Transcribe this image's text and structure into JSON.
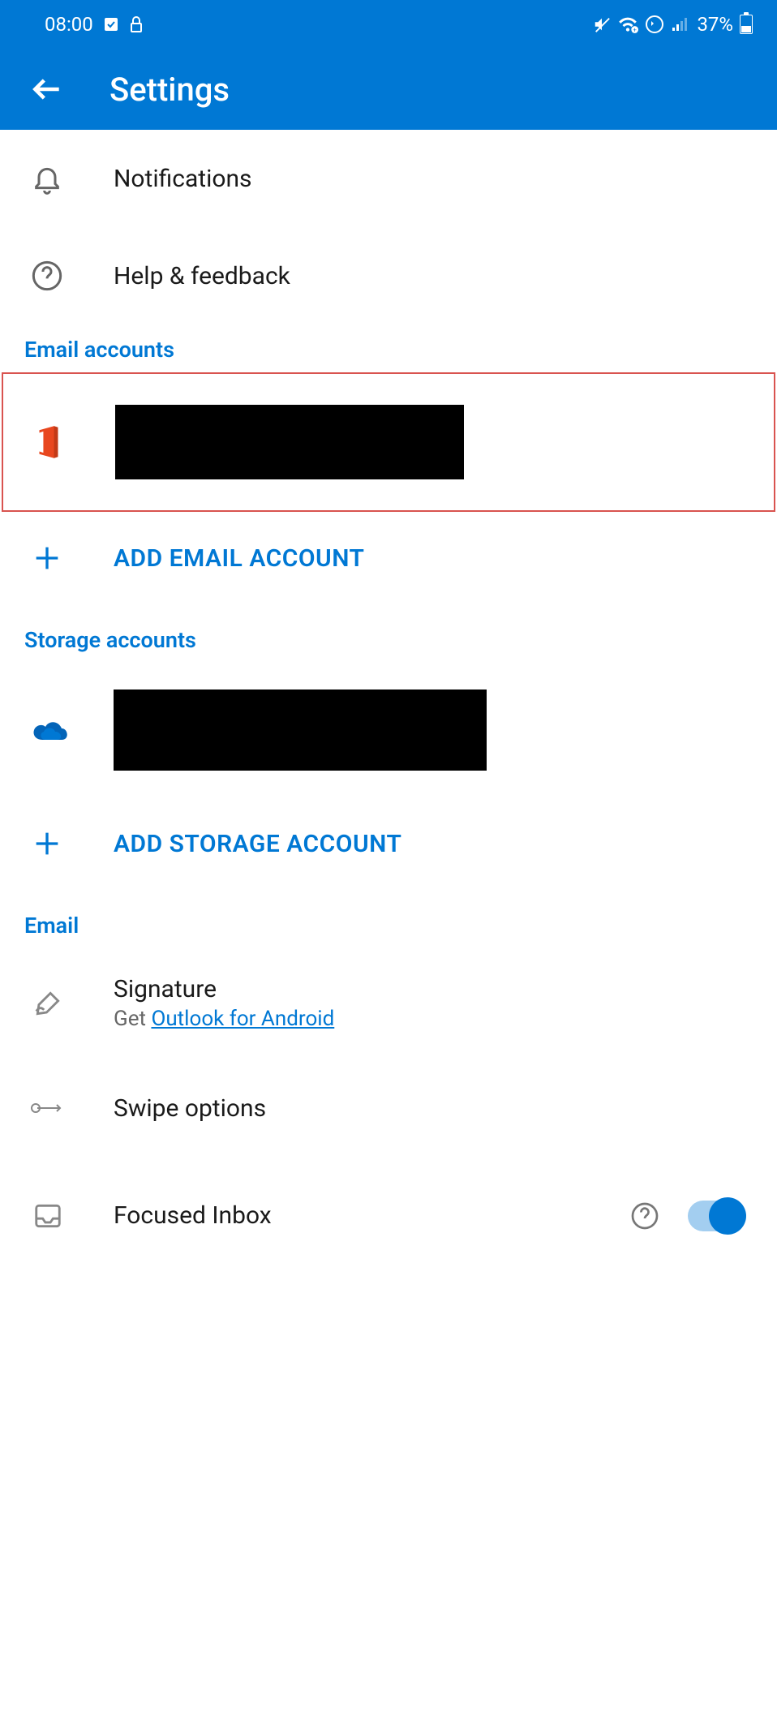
{
  "statusBar": {
    "time": "08:00",
    "battery": "37%"
  },
  "appBar": {
    "title": "Settings"
  },
  "items": {
    "notifications": "Notifications",
    "help": "Help & feedback"
  },
  "sections": {
    "emailAccounts": "Email accounts",
    "storageAccounts": "Storage accounts",
    "email": "Email"
  },
  "actions": {
    "addEmail": "ADD EMAIL ACCOUNT",
    "addStorage": "ADD STORAGE ACCOUNT"
  },
  "emailSection": {
    "signature": {
      "title": "Signature",
      "prefix": "Get ",
      "link": "Outlook for Android"
    },
    "swipe": "Swipe options",
    "focused": "Focused Inbox"
  }
}
